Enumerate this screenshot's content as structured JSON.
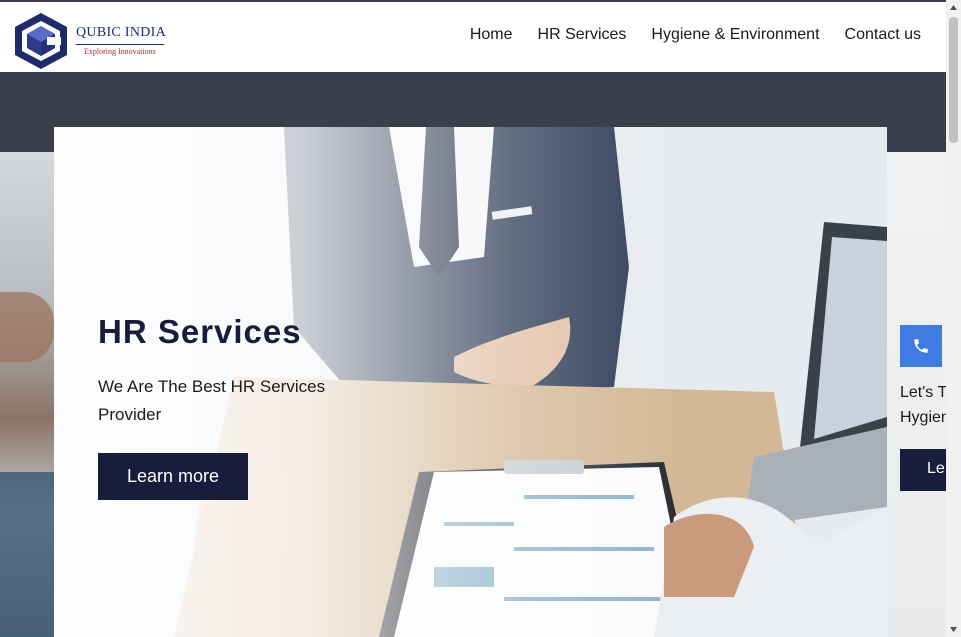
{
  "brand": {
    "name": "QUBIC INDIA",
    "tagline": "Exploring Innovations",
    "logo_icon": "cube-logo-icon",
    "colors": {
      "navy": "#1f2a6b",
      "accent_red": "#b02a2a"
    }
  },
  "nav": {
    "items": [
      {
        "label": "Home"
      },
      {
        "label": "HR Services"
      },
      {
        "label": "Hygiene & Environment"
      },
      {
        "label": "Contact us"
      }
    ]
  },
  "hero": {
    "title": "HR Services",
    "subtitle": "We Are The Best HR Services Provider",
    "cta_label": "Learn more",
    "colors": {
      "button_bg": "#171d3a",
      "band": "#3a3f4b"
    }
  },
  "next_slide": {
    "icon": "phone-icon",
    "text_line1": "Let's Ta",
    "text_line2": "Hygien",
    "cta_partial": "Le",
    "colors": {
      "call_button": "#3f7be0"
    }
  },
  "scrollbar": {
    "up_icon": "scroll-up-arrow-icon",
    "down_icon": "scroll-down-arrow-icon"
  }
}
